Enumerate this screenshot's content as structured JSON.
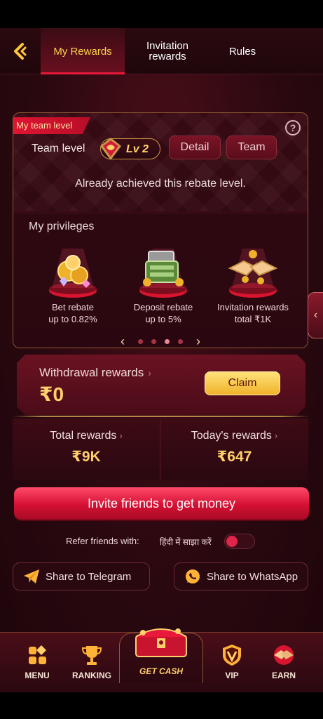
{
  "nav": {
    "tabs": [
      {
        "label": "My Rewards",
        "active": true
      },
      {
        "label": "Invitation\nrewards",
        "active": false
      },
      {
        "label": "Rules",
        "active": false
      }
    ]
  },
  "team": {
    "ribbon": "My team level",
    "level_label": "Team level",
    "level_value": "Lv 2",
    "detail_button": "Detail",
    "team_button": "Team",
    "achieved_text": "Already achieved this rebate level."
  },
  "privileges": {
    "title": "My privileges",
    "items": [
      {
        "line1": "Bet rebate",
        "line2": "up to 0.82%",
        "icon": "coins-gems-icon"
      },
      {
        "line1": "Deposit rebate",
        "line2": "up to 5%",
        "icon": "cash-chest-icon"
      },
      {
        "line1": "Invitation rewards",
        "line2": "total ₹1K",
        "icon": "handshake-icon"
      }
    ],
    "pager": {
      "pages": 4,
      "current": 3
    }
  },
  "withdrawal": {
    "label": "Withdrawal rewards",
    "amount": "₹0",
    "claim_button": "Claim"
  },
  "stats": {
    "total_label": "Total rewards",
    "total_value": "₹9K",
    "today_label": "Today's rewards",
    "today_value": "₹647"
  },
  "invite_button": "Invite friends to get money",
  "refer": {
    "label": "Refer friends with:",
    "hindi_label": "हिंदी में साझा करें",
    "toggle_on": false
  },
  "share": {
    "telegram": "Share to Telegram",
    "whatsapp": "Share to WhatsApp"
  },
  "bottom_nav": {
    "menu": "MENU",
    "ranking": "RANKING",
    "get_cash": "GET CASH",
    "vip": "VIP",
    "earn": "EARN"
  },
  "colors": {
    "accent_gold": "#ffd06b",
    "accent_red": "#e8193a",
    "background": "#2a0810"
  }
}
